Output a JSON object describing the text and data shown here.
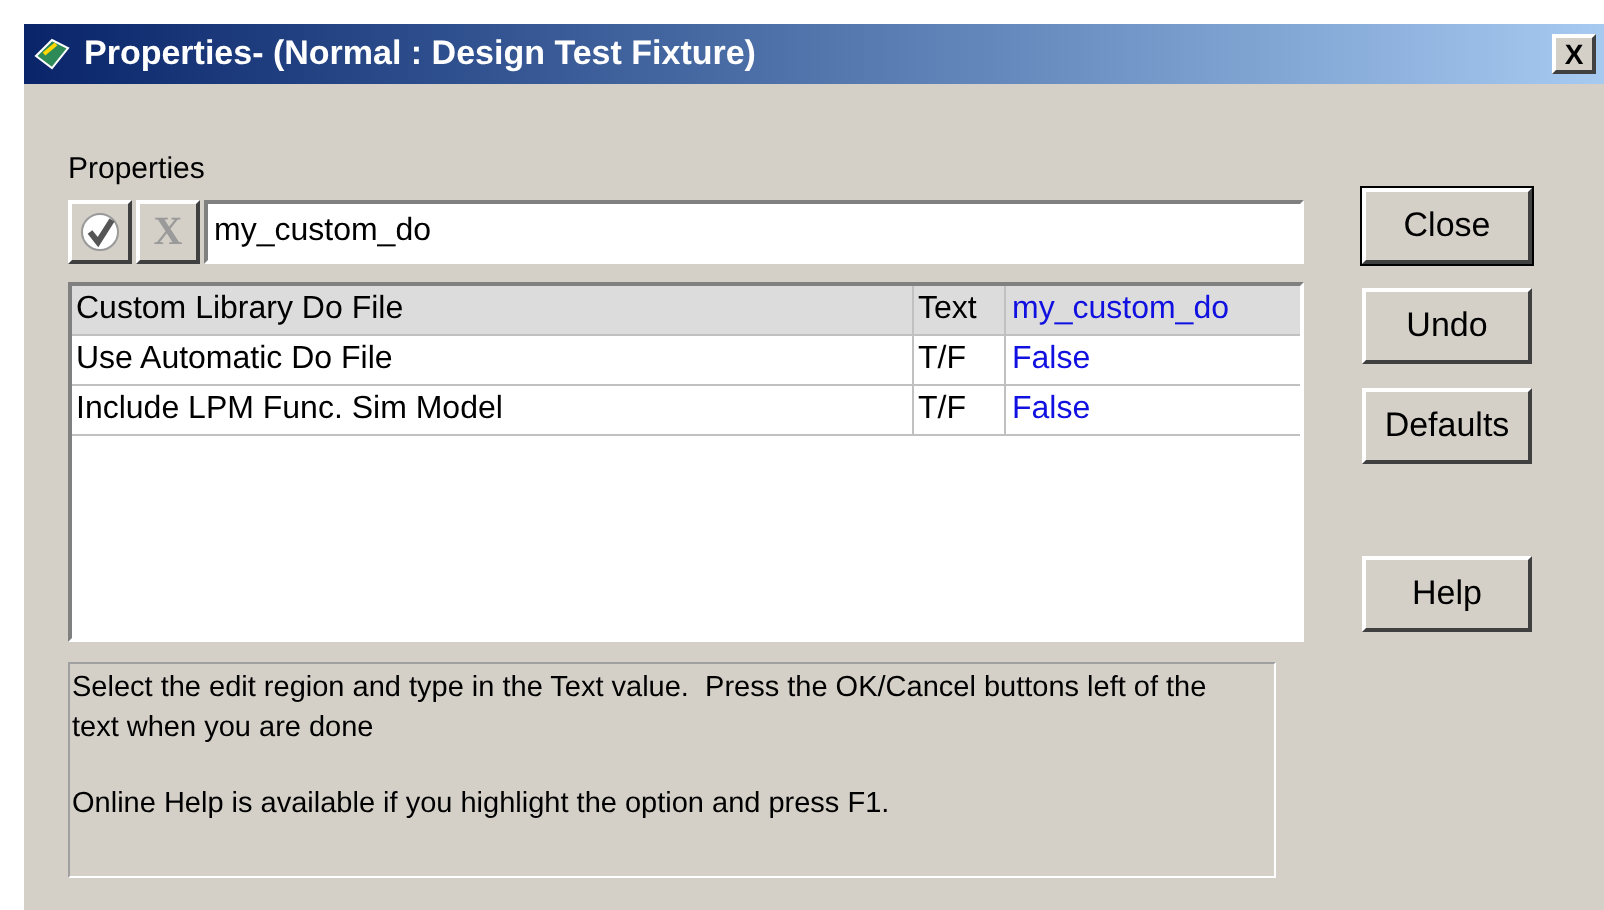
{
  "window": {
    "title": "Properties- (Normal : Design Test Fixture)",
    "close": "X"
  },
  "properties_label": "Properties",
  "edit_bar": {
    "ok_enabled": true,
    "cancel_enabled": false,
    "cancel_glyph": "X",
    "value": "my_custom_do"
  },
  "table": {
    "rows": [
      {
        "name": "Custom Library Do File",
        "type": "Text",
        "value": "my_custom_do",
        "selected": true
      },
      {
        "name": "Use Automatic Do File",
        "type": "T/F",
        "value": "False",
        "selected": false
      },
      {
        "name": "Include LPM Func. Sim Model",
        "type": "T/F",
        "value": "False",
        "selected": false
      }
    ]
  },
  "help_text": [
    "Select the edit region and type in the Text value.  Press the OK/Cancel buttons left of the text when you are done",
    "Online Help is available if you highlight the option and press F1."
  ],
  "buttons": [
    {
      "label": "Close",
      "default": true
    },
    {
      "label": "Undo",
      "default": false
    },
    {
      "label": "Defaults",
      "default": false
    },
    {
      "label": "Help",
      "default": false
    }
  ]
}
